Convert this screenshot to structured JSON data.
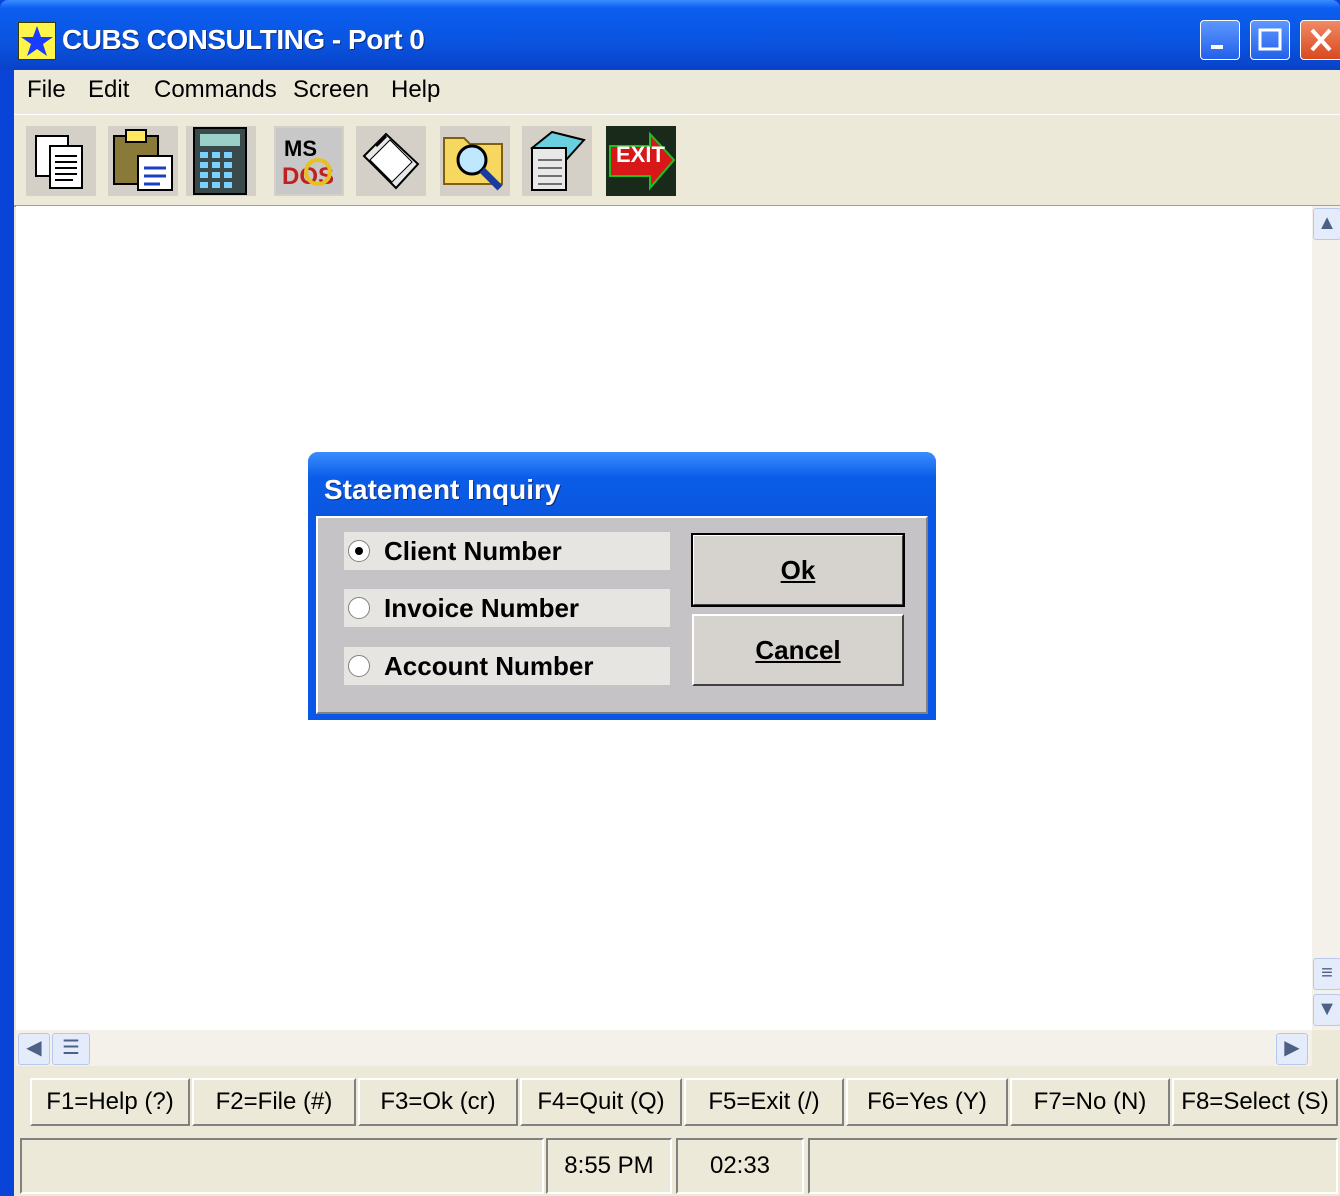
{
  "window": {
    "title": "CUBS CONSULTING - Port 0"
  },
  "menu": {
    "items": [
      "File",
      "Edit",
      "Commands",
      "Screen",
      "Help"
    ]
  },
  "toolbar": {
    "buttons": [
      {
        "icon": "copy-document-icon"
      },
      {
        "icon": "paste-clipboard-icon"
      },
      {
        "icon": "calculator-icon"
      },
      {
        "icon": "ms-dos-icon"
      },
      {
        "icon": "printer-icon"
      },
      {
        "icon": "folder-search-icon"
      },
      {
        "icon": "notepad-icon"
      },
      {
        "icon": "exit-icon",
        "label": "EXIT"
      }
    ]
  },
  "dialog": {
    "title": "Statement Inquiry",
    "options": [
      {
        "label": "Client Number",
        "selected": true
      },
      {
        "label": "Invoice Number",
        "selected": false
      },
      {
        "label": "Account Number",
        "selected": false
      }
    ],
    "ok_label": "Ok",
    "cancel_label": "Cancel"
  },
  "function_keys": [
    "F1=Help (?)",
    "F2=File (#)",
    "F3=Ok (cr)",
    "F4=Quit (Q)",
    "F5=Exit (/)",
    "F6=Yes (Y)",
    "F7=No (N)",
    "F8=Select (S)"
  ],
  "status": {
    "time": "8:55 PM",
    "elapsed": "02:33"
  },
  "colors": {
    "titlebar": "#0a54e0",
    "dialog_body": "#c6c3c6",
    "chrome": "#ece9d8"
  }
}
